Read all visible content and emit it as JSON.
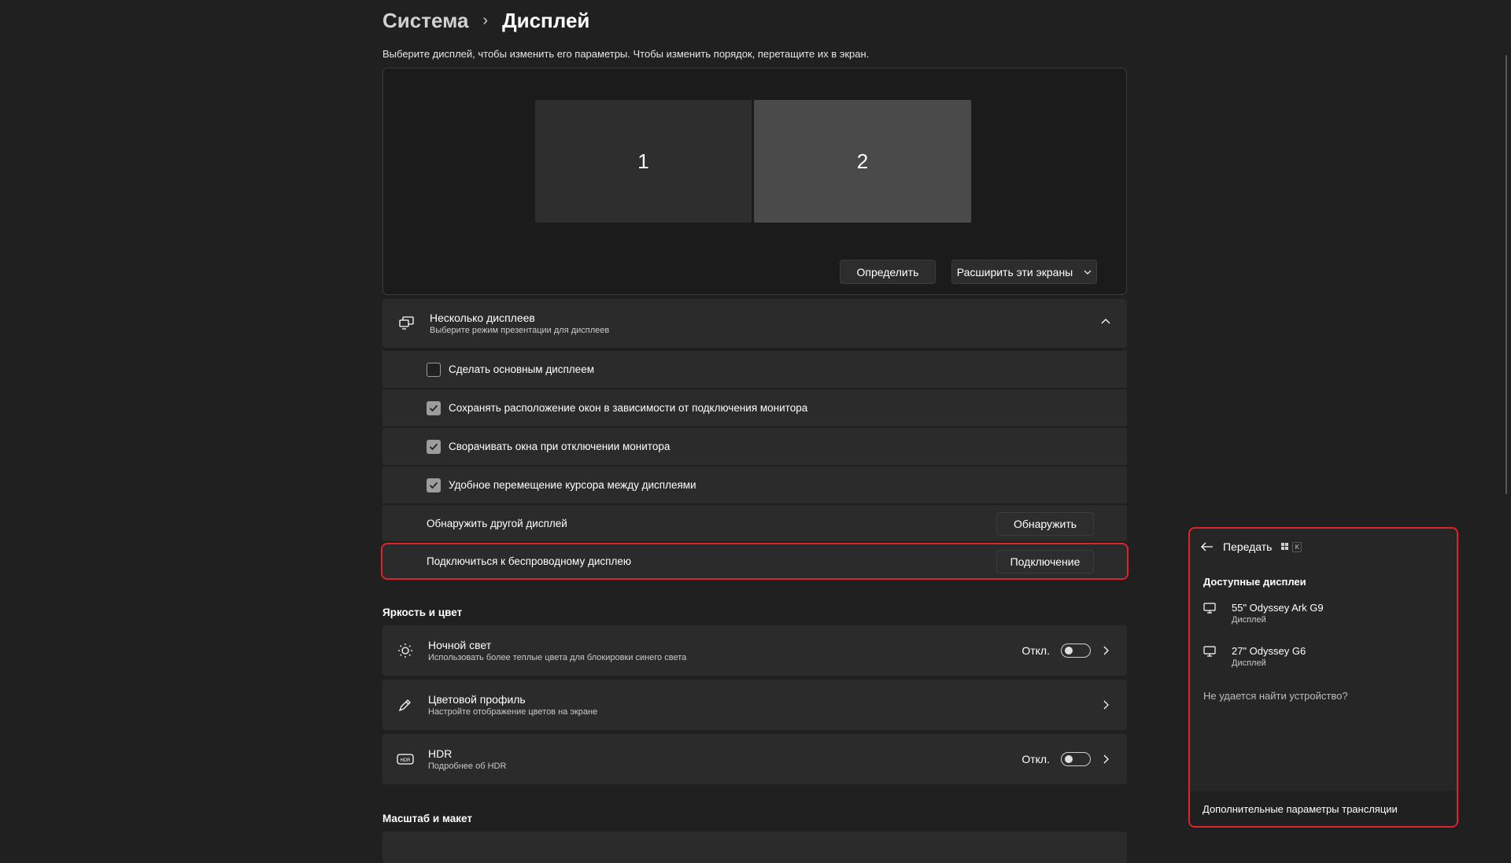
{
  "breadcrumb": {
    "parent": "Система",
    "current": "Дисплей"
  },
  "instructions": "Выберите дисплей, чтобы изменить его параметры. Чтобы изменить порядок, перетащите их в экран.",
  "arrangement": {
    "monitors": [
      "1",
      "2"
    ],
    "identify_button": "Определить",
    "extend_select": "Расширить эти экраны"
  },
  "multiple_displays": {
    "title": "Несколько дисплеев",
    "subtitle": "Выберите режим презентации для дисплеев",
    "options": [
      {
        "label": "Сделать основным дисплеем",
        "checked": false
      },
      {
        "label": "Сохранять расположение окон в зависимости от подключения монитора",
        "checked": true
      },
      {
        "label": "Сворачивать окна при отключении монитора",
        "checked": true
      },
      {
        "label": "Удобное перемещение курсора между дисплеями",
        "checked": true
      }
    ],
    "detect": {
      "label": "Обнаружить другой дисплей",
      "button": "Обнаружить"
    },
    "wireless": {
      "label": "Подключиться к беспроводному дисплею",
      "button": "Подключение"
    }
  },
  "brightness_section": {
    "title": "Яркость и цвет",
    "night_light": {
      "title": "Ночной свет",
      "subtitle": "Использовать более теплые цвета для блокировки синего света",
      "state": "Откл."
    },
    "color_profile": {
      "title": "Цветовой профиль",
      "subtitle": "Настройте отображение цветов на экране"
    },
    "hdr": {
      "title": "HDR",
      "subtitle": "Подробнее об HDR",
      "state": "Откл."
    }
  },
  "scale_section": {
    "title": "Масштаб и макет"
  },
  "cast_panel": {
    "title": "Передать",
    "shortcut_key": "K",
    "available_title": "Доступные дисплеи",
    "devices": [
      {
        "name": "55\" Odyssey Ark G9",
        "type": "Дисплей"
      },
      {
        "name": "27\" Odyssey G6",
        "type": "Дисплей"
      }
    ],
    "cant_find": "Не удается найти устройство?",
    "footer": "Дополнительные параметры трансляции"
  },
  "colors": {
    "highlight": "#e0222a",
    "background": "#202020",
    "card": "#2b2b2b"
  }
}
